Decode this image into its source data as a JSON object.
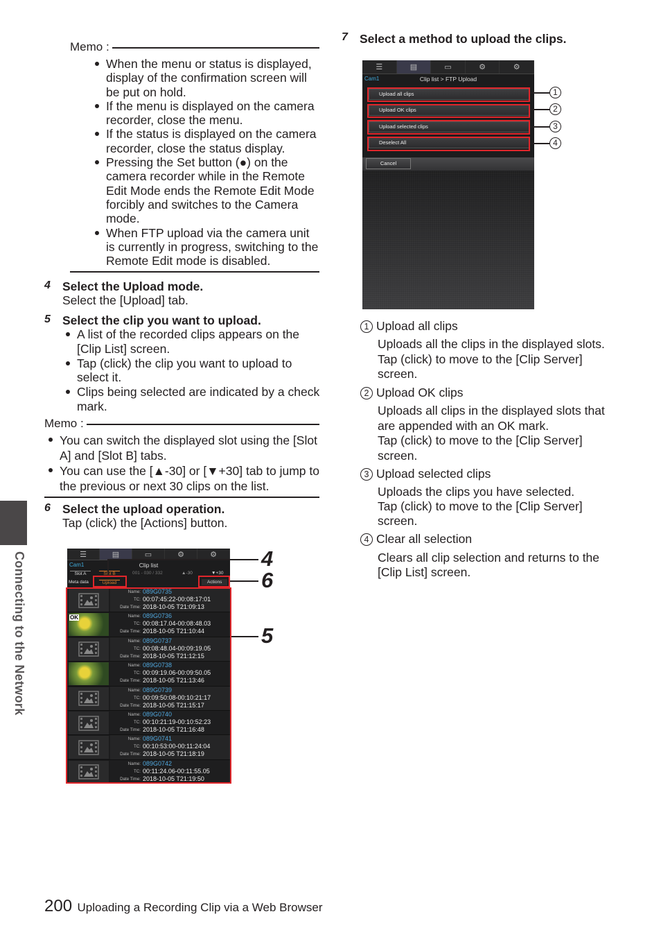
{
  "memo1": {
    "label": "Memo :",
    "bullets": [
      "When the menu or status is displayed, display of the confirmation screen will be put on hold.",
      "If the menu is displayed on the camera recorder, close the menu.",
      "If the status is displayed on the camera recorder, close the status display.",
      "Pressing the Set button (●) on the camera recorder while in the Remote Edit Mode ends the Remote Edit Mode forcibly and switches to the Camera mode.",
      "When FTP upload via the camera unit is currently in progress, switching to the Remote Edit mode is disabled."
    ]
  },
  "steps": {
    "s4": {
      "num": "4",
      "title": "Select the Upload mode.",
      "body": "Select the [Upload] tab."
    },
    "s5": {
      "num": "5",
      "title": "Select the clip you want to upload.",
      "bullets": [
        "A list of the recorded clips appears on the [Clip List] screen.",
        "Tap (click) the clip you want to upload to select it.",
        "Clips being selected are indicated by a check mark."
      ]
    },
    "s6": {
      "num": "6",
      "title": "Select the upload operation.",
      "body": "Tap (click) the [Actions] button."
    },
    "s7": {
      "num": "7",
      "title": "Select a method to upload the clips."
    }
  },
  "memo2": {
    "label": "Memo :",
    "bullets": [
      "You can switch the displayed slot using the [Slot A] and [Slot B] tabs.",
      "You can use the [▲-30] or [▼+30] tab to jump to the previous or next 30 clips on the list."
    ]
  },
  "side_tab": {
    "label": "Connecting to the Network"
  },
  "footer": {
    "page": "200",
    "title": "Uploading a Recording Clip via a Web Browser"
  },
  "ftp_screen": {
    "tabs": [
      "list-edit-icon",
      "clip-list-icon",
      "view-icon",
      "camera-settings-icon",
      "settings-gear-icon"
    ],
    "cam": "Cam1",
    "title": "Clip list > FTP Upload",
    "buttons": [
      "Upload all clips",
      "Upload OK clips",
      "Upload selected clips",
      "Deselect All"
    ],
    "cancel": "Cancel",
    "callouts": [
      "1",
      "2",
      "3",
      "4"
    ]
  },
  "descriptions": [
    {
      "num": "1",
      "title": "Upload all clips",
      "lines": [
        "Uploads all the clips in the displayed slots.",
        "Tap (click) to move to the [Clip Server]",
        "screen."
      ]
    },
    {
      "num": "2",
      "title": "Upload OK clips",
      "lines": [
        "Uploads all clips in the displayed slots that",
        "are appended with an OK mark.",
        "Tap (click) to move to the [Clip Server]",
        "screen."
      ]
    },
    {
      "num": "3",
      "title": "Upload selected clips",
      "lines": [
        "Uploads the clips you have selected.",
        "Tap (click) to move to the [Clip Server]",
        "screen."
      ]
    },
    {
      "num": "4",
      "title": "Clear all selection",
      "lines": [
        "Clears all clip selection and returns to the",
        "[Clip List] screen."
      ]
    }
  ],
  "cliplist_screen": {
    "cam": "Cam1",
    "title": "Clip list",
    "slot_a": "Slot A",
    "slot_b": "Slot B",
    "range": "001 - 030 / 332",
    "prev": "▲-30",
    "next": "▼+30",
    "meta": "Meta data",
    "upload": "Upload",
    "actions": "Actions",
    "labels": {
      "name": "Name:",
      "tc": "TC:",
      "date": "Date Time:"
    },
    "clips": [
      {
        "name": "089G0735",
        "tc": "00:07:45:22-00:08:17:01",
        "date": "2018-10-05 T21:09:13",
        "thumb": "placeholder",
        "ok": false
      },
      {
        "name": "089G0736",
        "tc": "00:08:17.04-00:08:48.03",
        "date": "2018-10-05 T21:10:44",
        "thumb": "photo",
        "ok": true
      },
      {
        "name": "089G0737",
        "tc": "00:08:48.04-00:09:19.05",
        "date": "2018-10-05 T21:12:15",
        "thumb": "placeholder",
        "ok": false
      },
      {
        "name": "089G0738",
        "tc": "00:09:19.06-00:09:50.05",
        "date": "2018-10-05 T21:13:46",
        "thumb": "photo",
        "ok": false
      },
      {
        "name": "089G0739",
        "tc": "00:09:50:08-00:10:21:17",
        "date": "2018-10-05 T21:15:17",
        "thumb": "placeholder",
        "ok": false
      },
      {
        "name": "089G0740",
        "tc": "00:10:21:19-00:10:52:23",
        "date": "2018-10-05 T21:16:48",
        "thumb": "placeholder",
        "ok": false
      },
      {
        "name": "089G0741",
        "tc": "00:10:53:00-00:11:24:04",
        "date": "2018-10-05 T21:18:19",
        "thumb": "placeholder",
        "ok": false
      },
      {
        "name": "089G0742",
        "tc": "00:11:24.06-00:11:55.05",
        "date": "2018-10-05 T21:19:50",
        "thumb": "placeholder",
        "ok": false
      }
    ],
    "ok_label": "OK",
    "callouts": [
      "4",
      "6",
      "5"
    ]
  },
  "colors": {
    "highlight_red": "#e0262b",
    "name_blue": "#4fa6dc",
    "cam_blue": "#3fa8d8",
    "upload_orange": "#e07b2a"
  }
}
